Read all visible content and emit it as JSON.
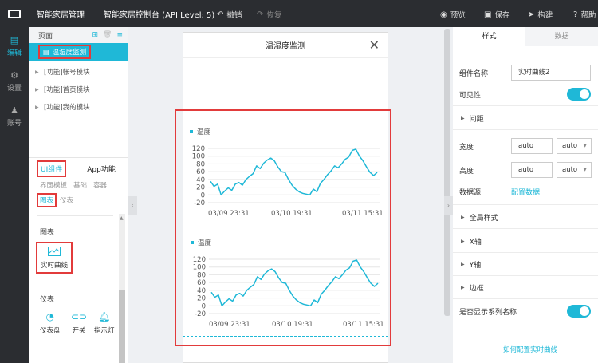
{
  "topbar": {
    "app_title": "智能家居管理",
    "console_title": "智能家居控制台 (API Level: 5)",
    "undo": "撤销",
    "redo": "恢复",
    "preview": "预览",
    "save": "保存",
    "build": "构建",
    "help": "帮助"
  },
  "rail": {
    "edit": "编辑",
    "settings": "设置",
    "account": "账号"
  },
  "pages": {
    "header": "页面",
    "items": [
      {
        "label": "温湿度监测"
      },
      {
        "label": "[功能]帐号模块"
      },
      {
        "label": "[功能]首页模块"
      },
      {
        "label": "[功能]我的模块"
      }
    ]
  },
  "components": {
    "tab_ui": "UI组件",
    "tab_app": "App功能",
    "subtabs": [
      "界面模板",
      "基础",
      "容器"
    ],
    "subtab_chart": "图表",
    "subtab_gauge": "仪表",
    "section_chart": "图表",
    "realtime_curve": "实时曲线",
    "section_gauge": "仪表",
    "gadgets": [
      "仪表盘",
      "开关",
      "指示灯"
    ]
  },
  "phone": {
    "title": "温湿度监测"
  },
  "charts": [
    {
      "legend": "温度"
    },
    {
      "legend": "温度"
    }
  ],
  "chart_data": [
    {
      "type": "line",
      "title": "",
      "series": [
        {
          "name": "温度",
          "values": [
            35,
            22,
            28,
            0,
            10,
            18,
            12,
            28,
            32,
            25,
            40,
            48,
            55,
            75,
            68,
            82,
            90,
            95,
            88,
            72,
            60,
            58,
            40,
            25,
            15,
            8,
            4,
            2,
            0,
            15,
            8,
            30,
            40,
            52,
            62,
            75,
            70,
            80,
            92,
            98,
            115,
            118,
            100,
            88,
            72,
            58,
            50,
            58
          ]
        }
      ],
      "x_tick_labels": [
        "03/09 23:31",
        "03/10 19:31",
        "03/11 15:31"
      ],
      "y_ticks": [
        -20,
        0,
        20,
        40,
        60,
        80,
        100,
        120
      ],
      "ylim": [
        -20,
        120
      ],
      "grid": true,
      "color": "#1fb8d7"
    },
    {
      "type": "line",
      "title": "",
      "series": [
        {
          "name": "温度",
          "values": [
            35,
            22,
            28,
            0,
            10,
            18,
            12,
            28,
            32,
            25,
            40,
            48,
            55,
            75,
            68,
            82,
            90,
            95,
            88,
            72,
            60,
            58,
            40,
            25,
            15,
            8,
            4,
            2,
            0,
            15,
            8,
            30,
            40,
            52,
            62,
            75,
            70,
            80,
            92,
            98,
            115,
            118,
            100,
            88,
            72,
            58,
            50,
            58
          ]
        }
      ],
      "x_tick_labels": [
        "03/09 23:31",
        "03/10 19:31",
        "03/11 15:31"
      ],
      "y_ticks": [
        -20,
        0,
        20,
        40,
        60,
        80,
        100,
        120
      ],
      "ylim": [
        -20,
        120
      ],
      "grid": true,
      "color": "#1fb8d7"
    }
  ],
  "props": {
    "tab_style": "样式",
    "tab_data": "数据",
    "name_label": "组件名称",
    "name_value": "实时曲线2",
    "visible_label": "可见性",
    "spacing": "间距",
    "width_label": "宽度",
    "width_value": "auto",
    "width_unit": "auto",
    "height_label": "高度",
    "height_value": "auto",
    "height_unit": "auto",
    "datasource_label": "数据源",
    "datasource_link": "配置数据",
    "global_style": "全局样式",
    "x_axis": "X轴",
    "y_axis": "Y轴",
    "border": "边框",
    "show_series_label": "是否显示系列名称",
    "help_link": "如何配置实时曲线"
  }
}
